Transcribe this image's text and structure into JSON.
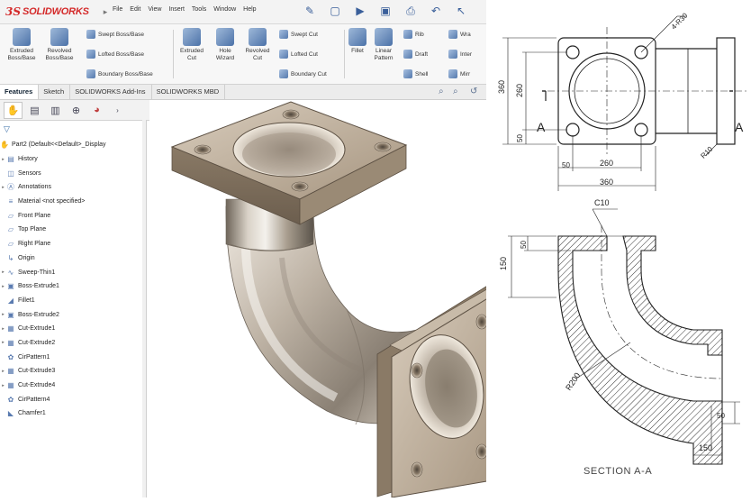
{
  "app": {
    "logo_mark": "3S",
    "logo_text": "SOLIDWORKS",
    "menu": [
      "File",
      "Edit",
      "View",
      "Insert",
      "Tools",
      "Window",
      "Help"
    ]
  },
  "ribbon": {
    "big_buttons": [
      {
        "line1": "Extruded",
        "line2": "Boss/Base"
      },
      {
        "line1": "Revolved",
        "line2": "Boss/Base"
      },
      {
        "line1": "Extruded",
        "line2": "Cut"
      },
      {
        "line1": "Hole",
        "line2": "Wizard"
      },
      {
        "line1": "Revolved",
        "line2": "Cut"
      },
      {
        "line1": "Fillet",
        "line2": ""
      },
      {
        "line1": "Linear",
        "line2": "Pattern"
      }
    ],
    "small_buttons": [
      "Swept Boss/Base",
      "Lofted Boss/Base",
      "Boundary Boss/Base",
      "Swept Cut",
      "Lofted Cut",
      "Boundary Cut",
      "Rib",
      "Draft",
      "Shell",
      "Wra",
      "Inter",
      "Mirr"
    ]
  },
  "tabs": [
    "Features",
    "Sketch",
    "SOLIDWORKS Add-Ins",
    "SOLIDWORKS MBD"
  ],
  "tree": {
    "root": "Part2  (Default<<Default>_Display",
    "items": [
      {
        "label": "History",
        "icon": "folder-icon",
        "expand": true
      },
      {
        "label": "Sensors",
        "icon": "sensor-icon",
        "expand": false
      },
      {
        "label": "Annotations",
        "icon": "annotation-icon",
        "expand": true
      },
      {
        "label": "Material <not specified>",
        "icon": "material-icon",
        "expand": false
      },
      {
        "label": "Front Plane",
        "icon": "plane-icon",
        "expand": false
      },
      {
        "label": "Top Plane",
        "icon": "plane-icon",
        "expand": false
      },
      {
        "label": "Right Plane",
        "icon": "plane-icon",
        "expand": false
      },
      {
        "label": "Origin",
        "icon": "origin-icon",
        "expand": false
      },
      {
        "label": "Sweep-Thin1",
        "icon": "sweep-icon",
        "expand": true
      },
      {
        "label": "Boss-Extrude1",
        "icon": "extrude-icon",
        "expand": true
      },
      {
        "label": "Fillet1",
        "icon": "fillet-icon",
        "expand": false
      },
      {
        "label": "Boss-Extrude2",
        "icon": "extrude-icon",
        "expand": true
      },
      {
        "label": "Cut-Extrude1",
        "icon": "cut-icon",
        "expand": true
      },
      {
        "label": "Cut-Extrude2",
        "icon": "cut-icon",
        "expand": true
      },
      {
        "label": "CirPattern1",
        "icon": "pattern-icon",
        "expand": false
      },
      {
        "label": "Cut-Extrude3",
        "icon": "cut-icon",
        "expand": true
      },
      {
        "label": "Cut-Extrude4",
        "icon": "cut-icon",
        "expand": true
      },
      {
        "label": "CirPattern4",
        "icon": "pattern-icon",
        "expand": false
      },
      {
        "label": "Chamfer1",
        "icon": "chamfer-icon",
        "expand": false
      }
    ]
  },
  "drawing": {
    "dims": {
      "hole_callout": "4-R30",
      "height_total": "360",
      "height_inner": "260",
      "height_edge": "50",
      "width_edge": "50",
      "width_inner": "260",
      "width_total": "360",
      "radius": "R10",
      "section_mark": "A",
      "chamfer": "C10",
      "flange_thk": "50",
      "flange_h": "150",
      "bend_radius": "R200",
      "bottom_thk": "50",
      "bottom_w": "150"
    },
    "section_title": "SECTION A-A"
  },
  "colors": {
    "logo_red": "#d42a2a",
    "part_metal": "#b8a996",
    "hatch": "#333333",
    "line": "#222222"
  }
}
